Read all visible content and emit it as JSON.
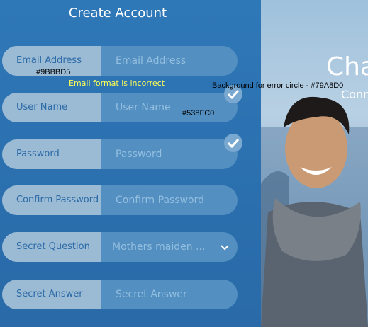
{
  "form": {
    "title": "Create Account",
    "fields": [
      {
        "label": "Email Address",
        "placeholder": "Email Address"
      },
      {
        "label": "User Name",
        "placeholder": "User Name"
      },
      {
        "label": "Password",
        "placeholder": "Password"
      },
      {
        "label": "Confirm Password",
        "placeholder": "Confirm Password"
      },
      {
        "label": "Secret Question",
        "value": "Mothers maiden ..."
      },
      {
        "label": "Secret Answer",
        "placeholder": "Secret Answer"
      }
    ],
    "error_message": "Email format is incorrect"
  },
  "annotations": {
    "label_color": "#9BBBD5",
    "error_circle": "Background for error circle - #79A8D0",
    "input_color": "#538FC0"
  },
  "hero": {
    "headline": "Cha",
    "subline": "Conn"
  },
  "colors": {
    "panel": "#2f78b8",
    "label_bg": "#9bbbd5",
    "input_bg": "#538fc0",
    "check_bg": "#79a8d0",
    "error_text": "#ffff55"
  },
  "icons": {
    "check": "check-icon",
    "chevron": "chevron-down-icon",
    "photo": "smiling-man-photo"
  }
}
